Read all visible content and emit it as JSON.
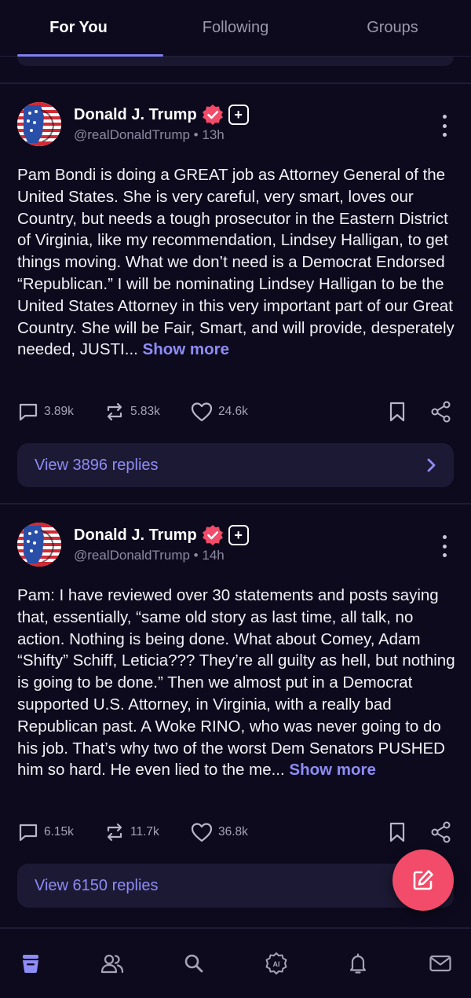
{
  "tabs": [
    {
      "label": "For You",
      "active": true
    },
    {
      "label": "Following",
      "active": false
    },
    {
      "label": "Groups",
      "active": false
    }
  ],
  "colors": {
    "background": "#0d0a1e",
    "accent": "#8e8cf5",
    "verified": "#f24c6a",
    "fab": "#f24c6a"
  },
  "posts": [
    {
      "author": "Donald J. Trump",
      "handle": "@realDonaldTrump",
      "time": "13h",
      "meta": "@realDonaldTrump • 13h",
      "text": "Pam Bondi is doing a GREAT job as Attorney General of the United States. She is very careful, very smart, loves our Country, but needs a tough prosecutor in the Eastern District of Virginia, like my recommendation, Lindsey Halligan, to get things moving. What we don’t need is a Democrat Endorsed “Republican.” I will be nominating Lindsey Halligan to be the United States Attorney in this very important part of our Great Country. She will be Fair, Smart, and will provide, desperately needed, JUSTI...",
      "show_more": "Show more",
      "replies_count": "3.89k",
      "reposts_count": "5.83k",
      "likes_count": "24.6k",
      "view_replies": "View 3896 replies",
      "avatar_icon": "flag-portrait-avatar",
      "verified_icon": "verified-badge-icon"
    },
    {
      "author": "Donald J. Trump",
      "handle": "@realDonaldTrump",
      "time": "14h",
      "meta": "@realDonaldTrump • 14h",
      "text": "Pam: I have reviewed over 30 statements and posts saying that, essentially, “same old story as last time, all talk, no action. Nothing is being done. What about Comey, Adam “Shifty” Schiff, Leticia??? They’re all guilty as hell, but nothing is going to be done.” Then we almost put in a Democrat supported U.S. Attorney, in Virginia, with a really bad Republican past. A Woke RINO, who was never going to do his job. That’s why two of the worst Dem Senators PUSHED him so hard. He even lied to the me...",
      "show_more": "Show more",
      "replies_count": "6.15k",
      "reposts_count": "11.7k",
      "likes_count": "36.8k",
      "view_replies": "View 6150 replies",
      "avatar_icon": "flag-portrait-avatar",
      "verified_icon": "verified-badge-icon"
    }
  ],
  "bottom_nav": [
    {
      "name": "home-icon",
      "active": true
    },
    {
      "name": "groups-icon",
      "active": false
    },
    {
      "name": "search-icon",
      "active": false
    },
    {
      "name": "ai-icon",
      "active": false,
      "label": "AI"
    },
    {
      "name": "notifications-icon",
      "active": false
    },
    {
      "name": "messages-icon",
      "active": false
    }
  ],
  "fab": {
    "icon": "compose-icon"
  }
}
